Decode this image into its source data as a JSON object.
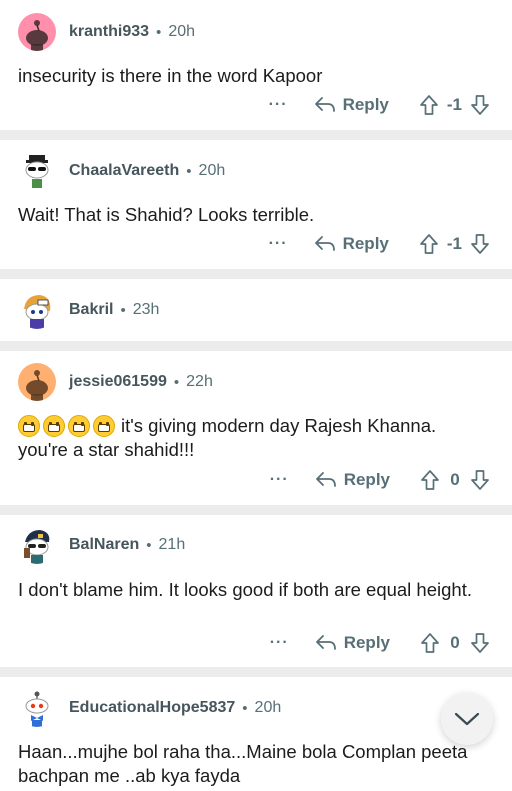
{
  "comments": [
    {
      "username": "kranthi933",
      "age": "20h",
      "text": "insecurity is there in the word Kapoor",
      "more": "···",
      "reply_label": "Reply",
      "score": "-1",
      "avatar": "snoo-pink-avatar"
    },
    {
      "username": "ChaalaVareeth",
      "age": "20h",
      "text": "Wait! That is Shahid? Looks terrible.",
      "more": "···",
      "reply_label": "Reply",
      "score": "-1",
      "avatar": "snoo-sunglasses-avatar"
    },
    {
      "username": "Bakril",
      "age": "23h",
      "avatar": "snoo-helmet-avatar"
    },
    {
      "username": "jessie061599",
      "age": "22h",
      "text": "it's giving modern day Rajesh Khanna. you're a star shahid!!!",
      "more": "···",
      "reply_label": "Reply",
      "score": "0",
      "avatar": "snoo-orange-avatar",
      "emoji_count": 4
    },
    {
      "username": "BalNaren",
      "age": "21h",
      "text": "I don't blame him. It looks good if both are equal height.",
      "more": "···",
      "reply_label": "Reply",
      "score": "0",
      "avatar": "snoo-captain-avatar"
    },
    {
      "username": "EducationalHope5837",
      "age": "20h",
      "text": "Haan...mujhe bol raha tha...Maine bola Complan peeta bachpan me ..ab kya fayda",
      "avatar": "snoo-bowtie-avatar"
    }
  ],
  "separator": "•",
  "colors": {
    "meta": "#576f76",
    "divider": "#ececec",
    "pink_avatar": "#ff8fab",
    "orange_avatar": "#ffb070"
  },
  "icons": [
    "reply-arrow-icon",
    "upvote-icon",
    "downvote-icon",
    "chevron-down-icon"
  ]
}
